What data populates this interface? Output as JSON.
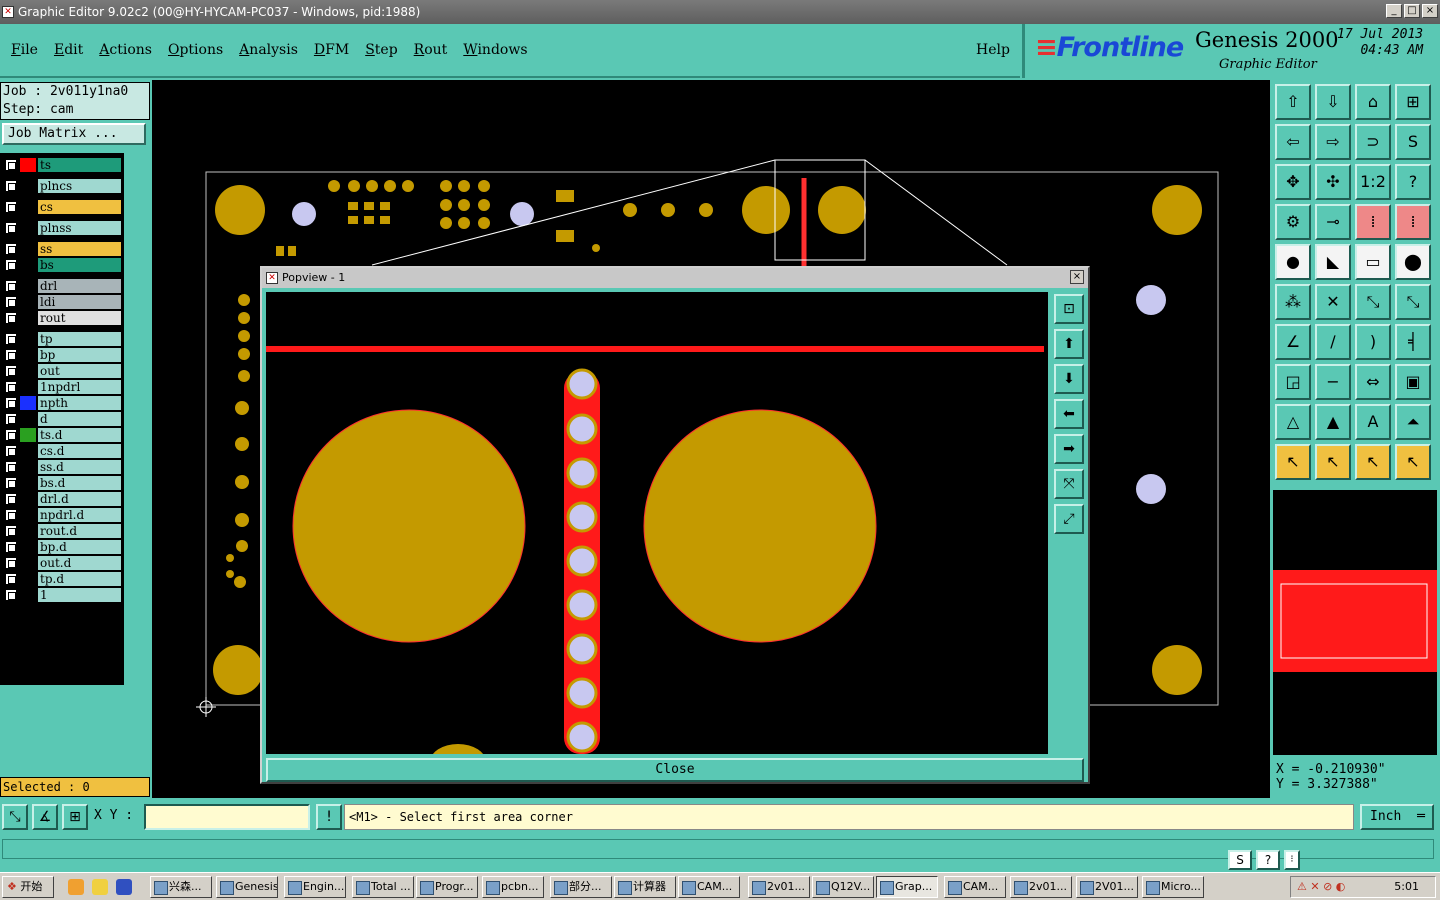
{
  "window": {
    "title": "Graphic Editor 9.02c2 (00@HY-HYCAM-PC037 - Windows, pid:1988)",
    "controls": [
      "_",
      "□",
      "×"
    ]
  },
  "menu": {
    "items": [
      "File",
      "Edit",
      "Actions",
      "Options",
      "Analysis",
      "DFM",
      "Step",
      "Rout",
      "Windows"
    ],
    "help": "Help"
  },
  "brand": {
    "logo": "Frontline",
    "product": "Genesis 2000",
    "subtitle": "Graphic Editor",
    "date": "17 Jul 2013",
    "time": "04:43 AM"
  },
  "job": {
    "job_line": "Job : 2v011y1na0",
    "step_line": "Step: cam",
    "matrix_label": "Job Matrix ..."
  },
  "layers": [
    {
      "name": "ts",
      "color": "#1e9b7a",
      "swatch": "#ff0000",
      "active": true
    },
    {
      "name": "plncs",
      "color": "#9fd8d0",
      "swatch": "#000000"
    },
    {
      "name": "cs",
      "color": "#f0c040",
      "swatch": "#000000"
    },
    {
      "name": "plnss",
      "color": "#9fd8d0",
      "swatch": "#000000"
    },
    {
      "name": "ss",
      "color": "#f0c040",
      "swatch": "#000000"
    },
    {
      "name": "bs",
      "color": "#1e9b7a",
      "swatch": "#000000"
    },
    {
      "name": "drl",
      "color": "#a8b4b8",
      "swatch": "#000000"
    },
    {
      "name": "ldi",
      "color": "#a8b4b8",
      "swatch": "#000000"
    },
    {
      "name": "rout",
      "color": "#e0e0e0",
      "swatch": "#000000"
    },
    {
      "name": "tp",
      "color": "#9fd8d0",
      "swatch": "#000000"
    },
    {
      "name": "bp",
      "color": "#9fd8d0",
      "swatch": "#000000"
    },
    {
      "name": "out",
      "color": "#9fd8d0",
      "swatch": "#000000"
    },
    {
      "name": "1npdrl",
      "color": "#9fd8d0",
      "swatch": "#000000"
    },
    {
      "name": "npth",
      "color": "#9fd8d0",
      "swatch": "#1a30ff"
    },
    {
      "name": "d",
      "color": "#9fd8d0",
      "swatch": "#000000"
    },
    {
      "name": "ts.d",
      "color": "#9fd8d0",
      "swatch": "#2aa020"
    },
    {
      "name": "cs.d",
      "color": "#9fd8d0",
      "swatch": "#000000"
    },
    {
      "name": "ss.d",
      "color": "#9fd8d0",
      "swatch": "#000000"
    },
    {
      "name": "bs.d",
      "color": "#9fd8d0",
      "swatch": "#000000"
    },
    {
      "name": "drl.d",
      "color": "#9fd8d0",
      "swatch": "#000000"
    },
    {
      "name": "npdrl.d",
      "color": "#9fd8d0",
      "swatch": "#000000"
    },
    {
      "name": "rout.d",
      "color": "#9fd8d0",
      "swatch": "#000000"
    },
    {
      "name": "bp.d",
      "color": "#9fd8d0",
      "swatch": "#000000"
    },
    {
      "name": "out.d",
      "color": "#9fd8d0",
      "swatch": "#000000"
    },
    {
      "name": "tp.d",
      "color": "#9fd8d0",
      "swatch": "#000000"
    },
    {
      "name": "1",
      "color": "#9fd8d0",
      "swatch": "#000000"
    }
  ],
  "selected": "Selected : 0",
  "popview": {
    "title": "Popview - 1",
    "close_label": "Close",
    "close_icon": "×"
  },
  "coords": {
    "x": "X = -0.210930\"",
    "y": "Y = 3.327388\""
  },
  "status": {
    "xy_label": "X Y :",
    "xy_value": "",
    "message": "<M1> - Select first area corner",
    "unit": "Inch"
  },
  "colors": {
    "panel": "#5ac8b4",
    "copper": "#c49a00",
    "drill": "#c8c8f0",
    "highlight": "#ff0000"
  },
  "taskbar": {
    "start": "开始",
    "items": [
      "兴森...",
      "Genesis",
      "Engin...",
      "Total ...",
      "Progr...",
      "pcbn...",
      "部分...",
      "计算器",
      "CAM...",
      "2v01...",
      "Q12V...",
      "Grap...",
      "CAM...",
      "2v01...",
      "2V01...",
      "Micro..."
    ],
    "active_index": 11,
    "clock": "5:01"
  }
}
